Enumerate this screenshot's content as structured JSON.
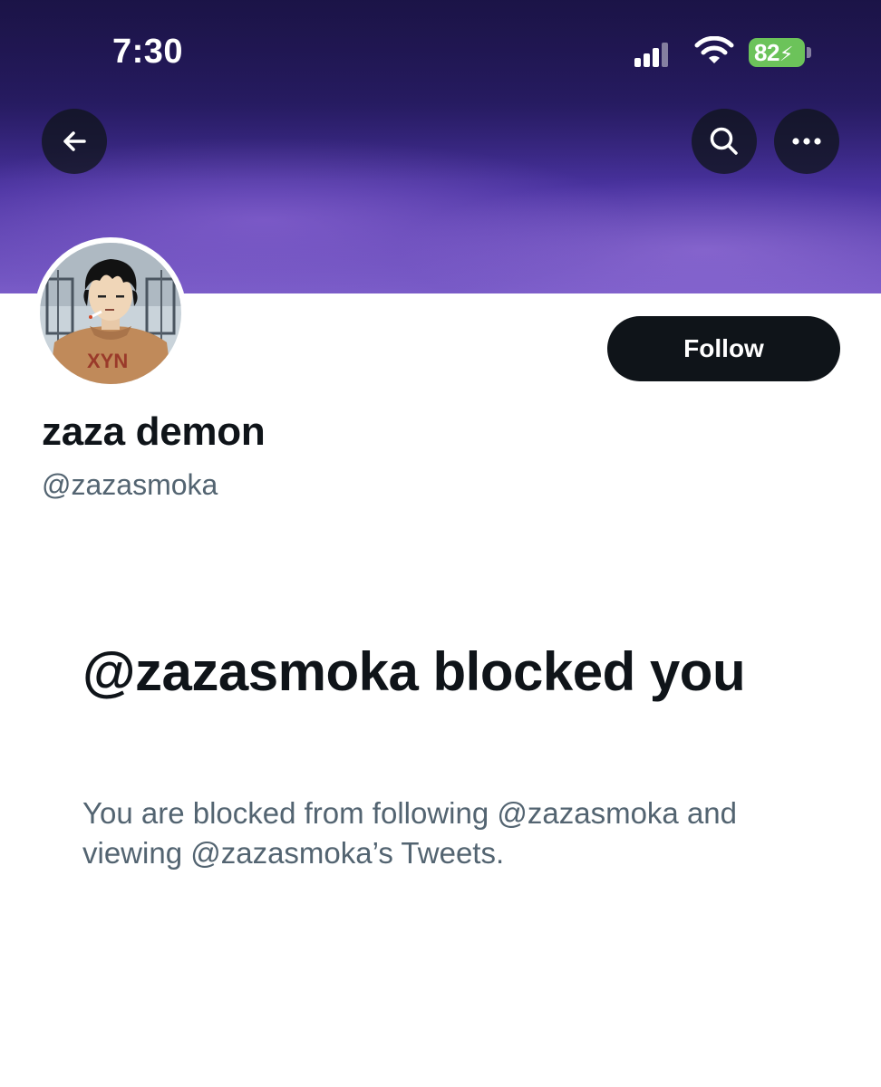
{
  "status_bar": {
    "time": "7:30",
    "battery_percent": "82",
    "battery_charging": true,
    "battery_color": "#6cc35a",
    "signal_icon": "cellular-signal-icon",
    "wifi_icon": "wifi-icon"
  },
  "banner": {
    "colors": [
      "#241a5a",
      "#4a33a0",
      "#7a5cc8"
    ]
  },
  "nav": {
    "back_icon": "arrow-left-icon",
    "search_icon": "search-icon",
    "more_icon": "more-horizontal-icon"
  },
  "profile": {
    "display_name": "zaza demon",
    "handle": "@zazasmoka",
    "follow_label": "Follow",
    "avatar_sweater_text": "XYN"
  },
  "blocked_notice": {
    "title": "@zazasmoka blocked you",
    "description": "You are blocked from following @zazasmoka and viewing @zazasmoka’s Tweets."
  },
  "colors": {
    "text_primary": "#0f1419",
    "text_secondary": "#536471",
    "button_dark": "#0f1419"
  }
}
